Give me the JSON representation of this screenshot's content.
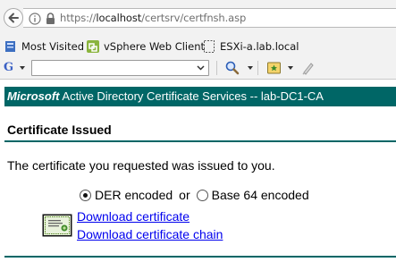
{
  "browser": {
    "url_prefix": "https://",
    "url_host": "localhost",
    "url_path": "/certsrv/certfnsh.asp",
    "bookmarks": [
      {
        "label": "Most Visited",
        "icon": "bookmarks-icon"
      },
      {
        "label": "vSphere Web Client",
        "icon": "vsphere-icon"
      },
      {
        "label": "ESXi-a.lab.local",
        "icon": "page-icon"
      }
    ],
    "google_toolbar": {
      "logo": "G",
      "search_value": ""
    }
  },
  "page": {
    "banner_brand": "Microsoft",
    "banner_title": " Active Directory Certificate Services  --  lab-DC1-CA",
    "section_title": "Certificate Issued",
    "message": "The certificate you requested was issued to you.",
    "encoding": {
      "option_der": "DER encoded",
      "separator": "or",
      "option_base64": "Base 64 encoded",
      "selected": "DER encoded"
    },
    "links": {
      "download_certificate": "Download certificate",
      "download_chain": "Download certificate chain"
    }
  },
  "colors": {
    "banner_bg": "#006666",
    "link": "#0000ee",
    "chrome_bg": "#f2f2f2"
  }
}
